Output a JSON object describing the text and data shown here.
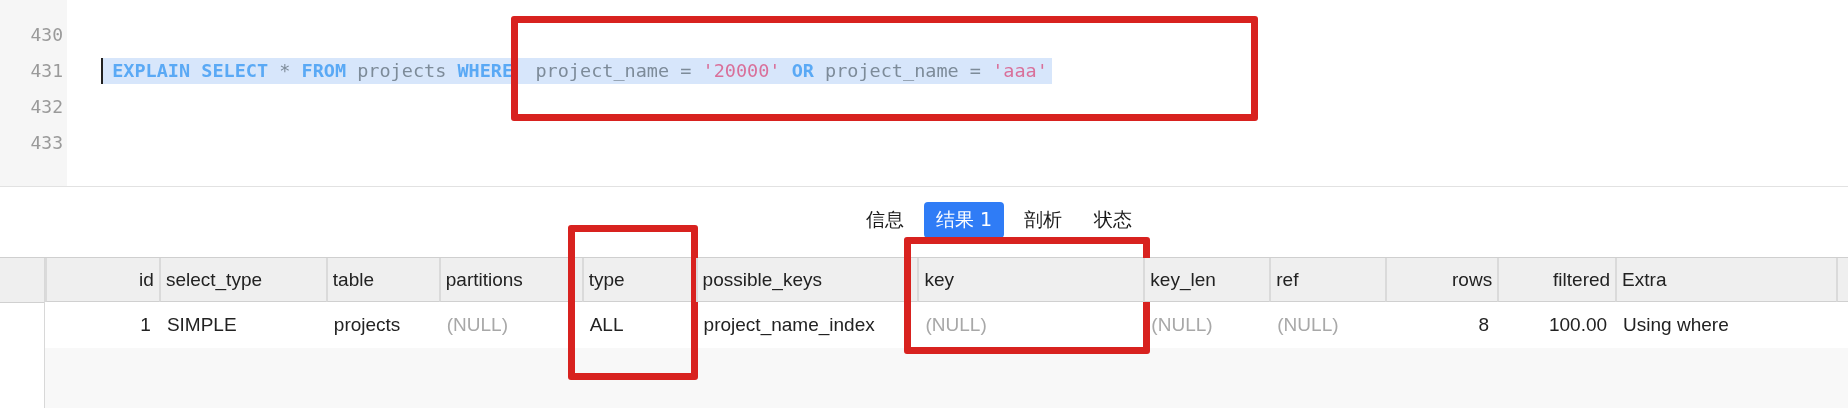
{
  "editor": {
    "lines": [
      {
        "number": "430",
        "selected": false
      },
      {
        "number": "431",
        "selected": true,
        "tokens": [
          {
            "kind": "keyword",
            "text": "EXPLAIN"
          },
          {
            "kind": "keyword",
            "text": "SELECT"
          },
          {
            "kind": "plain",
            "text": "*"
          },
          {
            "kind": "keyword",
            "text": "FROM"
          },
          {
            "kind": "plain",
            "text": "projects"
          },
          {
            "kind": "keyword",
            "text": "WHERE"
          }
        ],
        "boxed_tokens": [
          {
            "kind": "plain",
            "text": "project_name"
          },
          {
            "kind": "plain",
            "text": "="
          },
          {
            "kind": "string",
            "text": "'20000'"
          },
          {
            "kind": "keyword",
            "text": "OR"
          },
          {
            "kind": "plain",
            "text": "project_name"
          },
          {
            "kind": "plain",
            "text": "="
          },
          {
            "kind": "string",
            "text": "'aaa'"
          }
        ]
      },
      {
        "number": "432",
        "selected": false
      },
      {
        "number": "433",
        "selected": false
      }
    ]
  },
  "tabs": [
    {
      "label": "信息",
      "selected": false
    },
    {
      "label": "结果 1",
      "selected": true
    },
    {
      "label": "剖析",
      "selected": false
    },
    {
      "label": "状态",
      "selected": false
    }
  ],
  "table": {
    "columns": [
      {
        "label": "id",
        "boxed": false
      },
      {
        "label": "select_type",
        "boxed": false
      },
      {
        "label": "table",
        "boxed": false
      },
      {
        "label": "partitions",
        "boxed": false
      },
      {
        "label": "type",
        "boxed": true
      },
      {
        "label": "possible_keys",
        "boxed": false
      },
      {
        "label": "key",
        "boxed": true
      },
      {
        "label": "key_len",
        "boxed": false
      },
      {
        "label": "ref",
        "boxed": false
      },
      {
        "label": "rows",
        "boxed": false
      },
      {
        "label": "filtered",
        "boxed": false
      },
      {
        "label": "Extra",
        "boxed": false
      }
    ],
    "rows": [
      {
        "cells": [
          {
            "text": "1",
            "null": false
          },
          {
            "text": "SIMPLE",
            "null": false
          },
          {
            "text": "projects",
            "null": false
          },
          {
            "text": "(NULL)",
            "null": true
          },
          {
            "text": "ALL",
            "null": false
          },
          {
            "text": "project_name_index",
            "null": false
          },
          {
            "text": "(NULL)",
            "null": true
          },
          {
            "text": "(NULL)",
            "null": true
          },
          {
            "text": "(NULL)",
            "null": true
          },
          {
            "text": "8",
            "null": false
          },
          {
            "text": "100.00",
            "null": false
          },
          {
            "text": "Using where",
            "null": false
          }
        ]
      }
    ]
  }
}
